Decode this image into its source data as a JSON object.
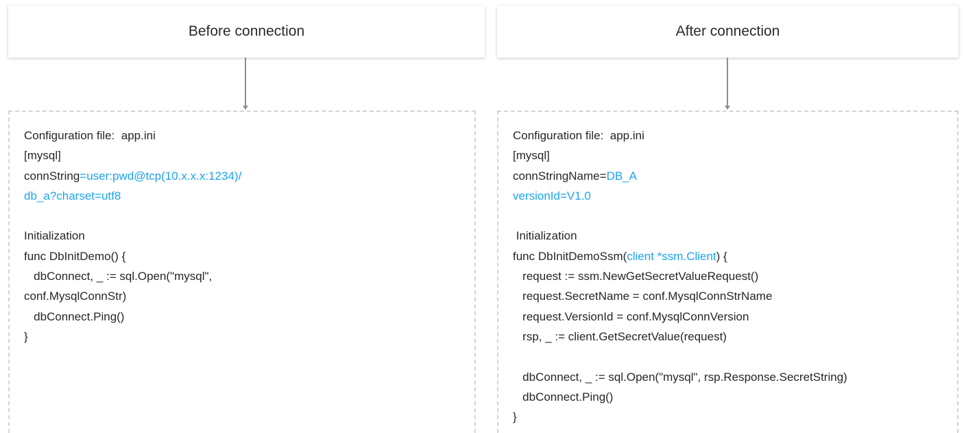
{
  "colors": {
    "text": "#262626",
    "highlight": "#1aa3f0",
    "connector": "#8c8c8c",
    "dashed_border": "#d4d4d4"
  },
  "left": {
    "header": "Before connection",
    "lines": [
      {
        "text": "Configuration file:  app.ini"
      },
      {
        "text": "[mysql]"
      },
      {
        "text": "connString",
        "highlight": "=user:pwd@tcp(10.x.x.x:1234)/"
      },
      {
        "highlight": "db_a?charset=utf8"
      },
      {
        "text": ""
      },
      {
        "text": "Initialization"
      },
      {
        "text": "func DbInitDemo() {"
      },
      {
        "text": "   dbConnect, _ := sql.Open(\"mysql\","
      },
      {
        "text": "conf.MysqlConnStr)"
      },
      {
        "text": "   dbConnect.Ping()"
      },
      {
        "text": "}"
      }
    ]
  },
  "right": {
    "header": "After connection",
    "lines": [
      {
        "text": "Configuration file:  app.ini"
      },
      {
        "text": "[mysql]"
      },
      {
        "text": "connStringName=",
        "highlight": "DB_A"
      },
      {
        "highlight": "versionId=V1.0"
      },
      {
        "text": ""
      },
      {
        "text": " Initialization"
      },
      {
        "text": "func DbInitDemoSsm(",
        "highlight": "client *ssm.Client",
        "suffix": ") {"
      },
      {
        "text": "   request := ssm.NewGetSecretValueRequest()"
      },
      {
        "text": "   request.SecretName = conf.MysqlConnStrName"
      },
      {
        "text": "   request.VersionId = conf.MysqlConnVersion"
      },
      {
        "text": "   rsp, _ := client.GetSecretValue(request)"
      },
      {
        "text": ""
      },
      {
        "text": "   dbConnect, _ := sql.Open(\"mysql\", rsp.Response.SecretString)"
      },
      {
        "text": "   dbConnect.Ping()"
      },
      {
        "text": "}"
      }
    ]
  }
}
